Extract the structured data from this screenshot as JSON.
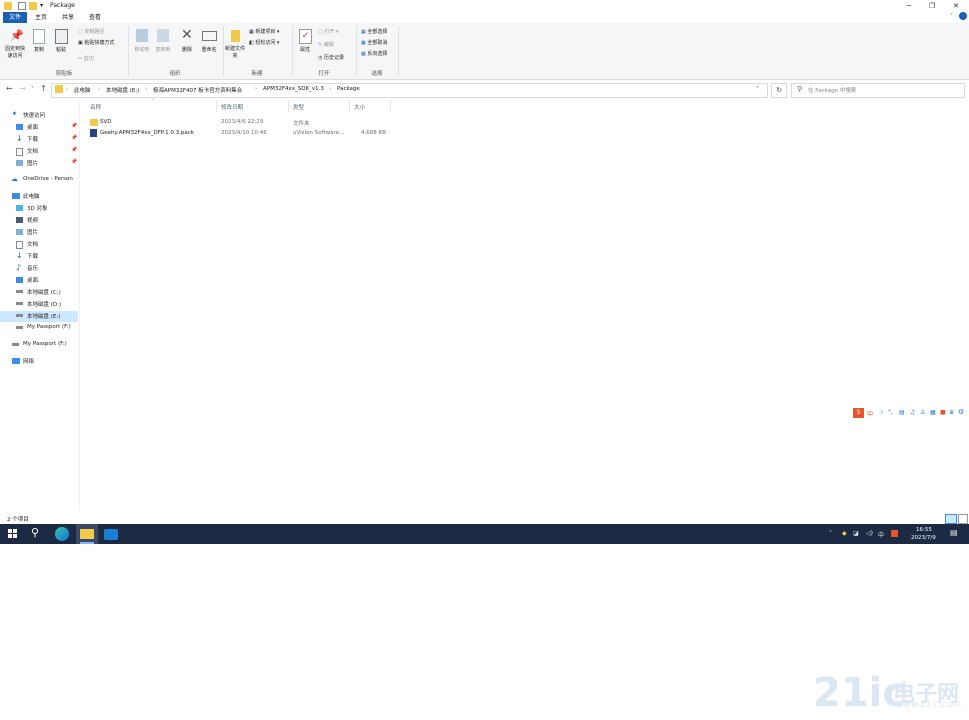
{
  "window": {
    "title": "Package",
    "minimize": "─",
    "restore": "❐",
    "close": "✕"
  },
  "ribbon_tabs": [
    "文件",
    "主页",
    "共享",
    "查看"
  ],
  "ribbon": {
    "clipboard": {
      "label": "剪贴板",
      "pin": "固定到快速访问",
      "copy": "复制",
      "paste": "粘贴",
      "copy_path": "复制路径",
      "paste_shortcut": "粘贴快捷方式",
      "cut": "剪切"
    },
    "organize": {
      "label": "组织",
      "move_to": "移动到",
      "copy_to": "复制到",
      "delete": "删除",
      "rename": "重命名"
    },
    "new": {
      "label": "新建",
      "new_folder": "新建文件夹",
      "new_item": "新建项目",
      "easy_access": "轻松访问"
    },
    "open": {
      "label": "打开",
      "properties": "属性",
      "open": "打开",
      "edit": "编辑",
      "history": "历史记录"
    },
    "select": {
      "label": "选择",
      "select_all": "全部选择",
      "select_none": "全部取消",
      "invert": "反向选择"
    }
  },
  "address": {
    "crumbs": [
      "此电脑",
      "本地磁盘 (E:)",
      "极海APM32F407 板卡官方资料集合",
      "APM32F4xx_SDK_v1.3",
      "Package"
    ],
    "search_placeholder": "在 Package 中搜索"
  },
  "nav": {
    "quick_access": "快速访问",
    "quick_items": [
      "桌面",
      "下载",
      "文档",
      "图片"
    ],
    "onedrive": "OneDrive - Person",
    "this_pc": "此电脑",
    "pc_items": [
      "3D 对象",
      "视频",
      "图片",
      "文档",
      "下载",
      "音乐",
      "桌面",
      "本地磁盘 (C:)",
      "本地磁盘 (D:)",
      "本地磁盘 (E:)",
      "My Passport (F:)"
    ],
    "my_passport": "My Passport (F:)",
    "network": "网络"
  },
  "columns": {
    "name": "名称",
    "date": "修改日期",
    "type": "类型",
    "size": "大小"
  },
  "files": [
    {
      "name": "SVD",
      "date": "2023/4/6 22:29",
      "type": "文件夹",
      "size": ""
    },
    {
      "name": "Geehy.APM32F4xx_DFP.1.0.3.pack",
      "date": "2023/4/10 10:46",
      "type": "uVision Software...",
      "size": "4,688 KB"
    }
  ],
  "status": {
    "count": "2 个项目"
  },
  "taskbar": {
    "time": "16:55",
    "date": "2023/7/9",
    "ime": "中"
  },
  "ime_toolbar": [
    "中",
    "⚙"
  ],
  "watermark": {
    "logo": "21ic",
    "name": "电子网",
    "sub": "www.21ic.com"
  }
}
